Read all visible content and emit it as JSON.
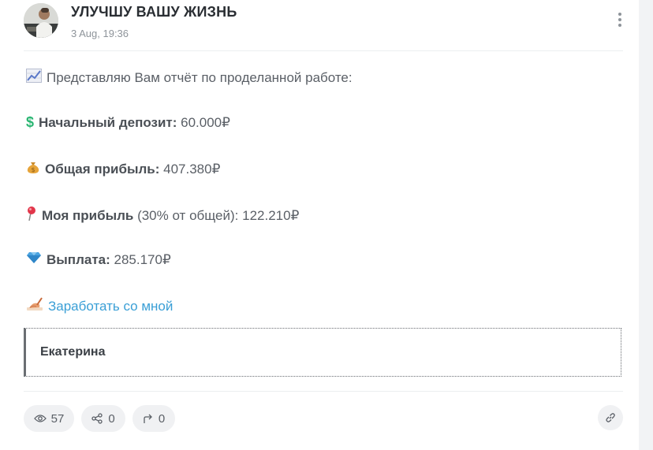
{
  "post": {
    "channel_name": "УЛУЧШУ ВАШУ ЖИЗНЬ",
    "date": "3 Aug, 19:36",
    "more_icon": "more-vertical-icon",
    "intro": {
      "emoji": "📈",
      "text": "Представляю Вам отчёт по проделанной работе:"
    },
    "lines": [
      {
        "emoji": "💲",
        "label": "Начальный депозит:",
        "note": "",
        "value": " 60.000₽"
      },
      {
        "emoji": "💰",
        "label": "Общая прибыль:",
        "note": "",
        "value": " 407.380₽"
      },
      {
        "emoji": "📍",
        "label": "Моя прибыль",
        "note": " (30% от общей):",
        "value": " 122.210₽"
      },
      {
        "emoji": "💎",
        "label": "Выплата:",
        "note": "",
        "value": " 285.170₽"
      }
    ],
    "cta": {
      "emoji": "✍️",
      "text": "Заработать со мной"
    },
    "quote": {
      "text": "Екатерина"
    }
  },
  "footer": {
    "views": "57",
    "shares": "0",
    "forwards": "0",
    "icons": [
      "eye-icon",
      "share-icon",
      "forward-icon",
      "link-icon"
    ]
  },
  "colors": {
    "link": "#3a9fd6",
    "text": "#5a5f66",
    "title": "#2a2e33",
    "muted": "#8e949a",
    "pill_bg": "#f0f1f3"
  }
}
